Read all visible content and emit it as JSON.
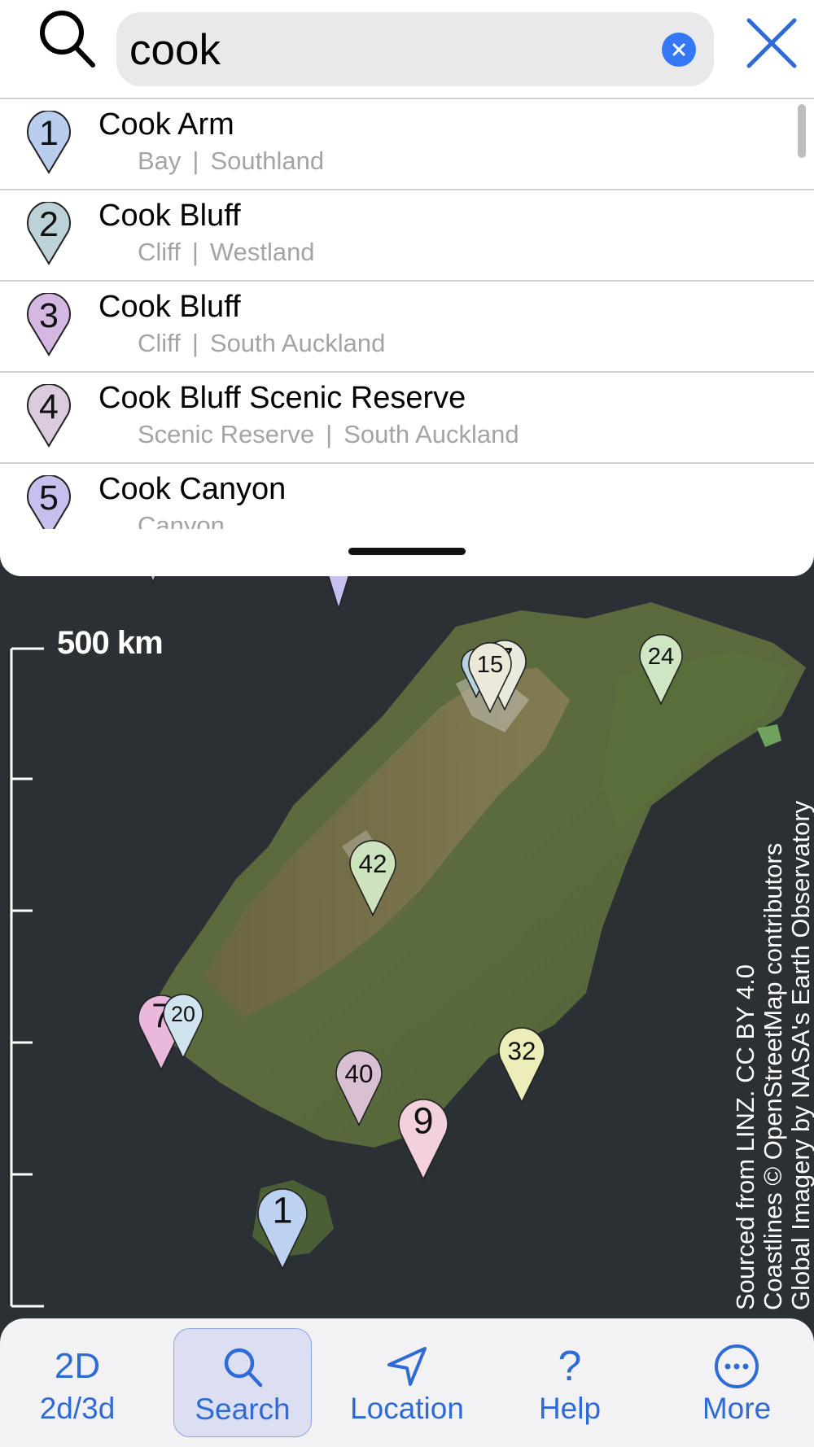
{
  "search": {
    "query": "cook",
    "placeholder": ""
  },
  "results": [
    {
      "number": "1",
      "title": "Cook Arm",
      "type": "Bay",
      "region": "Southland",
      "pin_color": "#b9cdef"
    },
    {
      "number": "2",
      "title": "Cook Bluff",
      "type": "Cliff",
      "region": "Westland",
      "pin_color": "#bcd2d8"
    },
    {
      "number": "3",
      "title": "Cook Bluff",
      "type": "Cliff",
      "region": "South Auckland",
      "pin_color": "#d4b8e2"
    },
    {
      "number": "4",
      "title": "Cook Bluff Scenic Reserve",
      "type": "Scenic Reserve",
      "region": "South Auckland",
      "pin_color": "#dccbdf"
    },
    {
      "number": "5",
      "title": "Cook Canyon",
      "type": "Canyon",
      "region": "",
      "pin_color": "#c6c0ee"
    }
  ],
  "separator": "|",
  "map": {
    "scale_label": "500 km",
    "markers": [
      {
        "label": "15",
        "color": "#ece9db"
      },
      {
        "label": "2",
        "color": "#b9d3de"
      },
      {
        "label": "7",
        "color": "#e8eadd"
      },
      {
        "label": "24",
        "color": "#cfe6c2"
      },
      {
        "label": "42",
        "color": "#cde3be"
      },
      {
        "label": "20",
        "color": "#cfe4ef"
      },
      {
        "label": "7",
        "color": "#e9b8dc"
      },
      {
        "label": "40",
        "color": "#d8c0d2"
      },
      {
        "label": "32",
        "color": "#ecedb9"
      },
      {
        "label": "9",
        "color": "#f2d0dd"
      },
      {
        "label": "1",
        "color": "#bdd2f1"
      }
    ],
    "attribution": [
      "Sourced from LINZ. CC BY 4.0",
      "Coastlines © OpenStreetMap contributors",
      "Global Imagery by NASA's Earth Observatory"
    ]
  },
  "tabs": [
    {
      "icon_text": "2D",
      "label": "2d/3d",
      "icon": "2d-text-icon"
    },
    {
      "icon_text": "",
      "label": "Search",
      "icon": "search-icon"
    },
    {
      "icon_text": "",
      "label": "Location",
      "icon": "location-arrow-icon"
    },
    {
      "icon_text": "?",
      "label": "Help",
      "icon": "question-mark-icon"
    },
    {
      "icon_text": "",
      "label": "More",
      "icon": "ellipsis-circle-icon"
    }
  ],
  "colors": {
    "accent": "#2f6bd6",
    "clear_button": "#3478f6",
    "secondary_text": "#a4a4a8"
  }
}
